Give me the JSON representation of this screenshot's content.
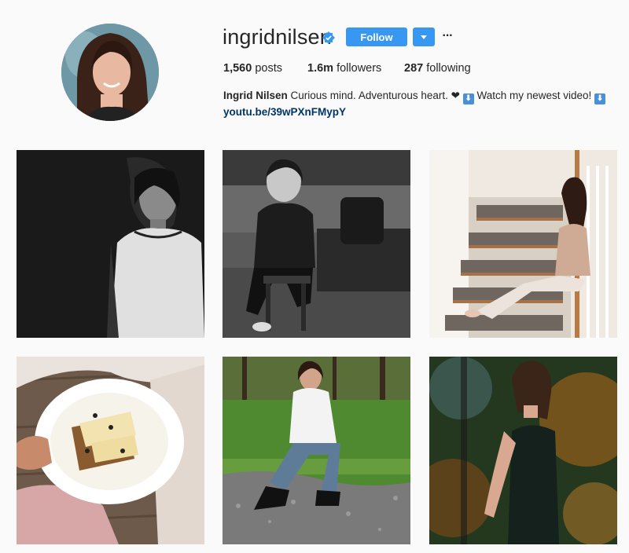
{
  "profile": {
    "username": "ingridnilsen",
    "verified_icon": "verified-badge-icon",
    "follow_label": "Follow",
    "more_label": "···",
    "stats": {
      "posts_count": "1,560",
      "posts_label": "posts",
      "followers_count": "1.6m",
      "followers_label": "followers",
      "following_count": "287",
      "following_label": "following"
    },
    "bio": {
      "name": "Ingrid Nilsen",
      "text": "Curious mind. Adventurous heart.",
      "heart": "❤",
      "arrow_emoji": "⬇",
      "watch_text": "Watch my newest video!",
      "link": "youtu.be/39wPXnFMypY"
    }
  },
  "colors": {
    "accent": "#3897f0",
    "link": "#003569",
    "background": "#fafafa"
  }
}
